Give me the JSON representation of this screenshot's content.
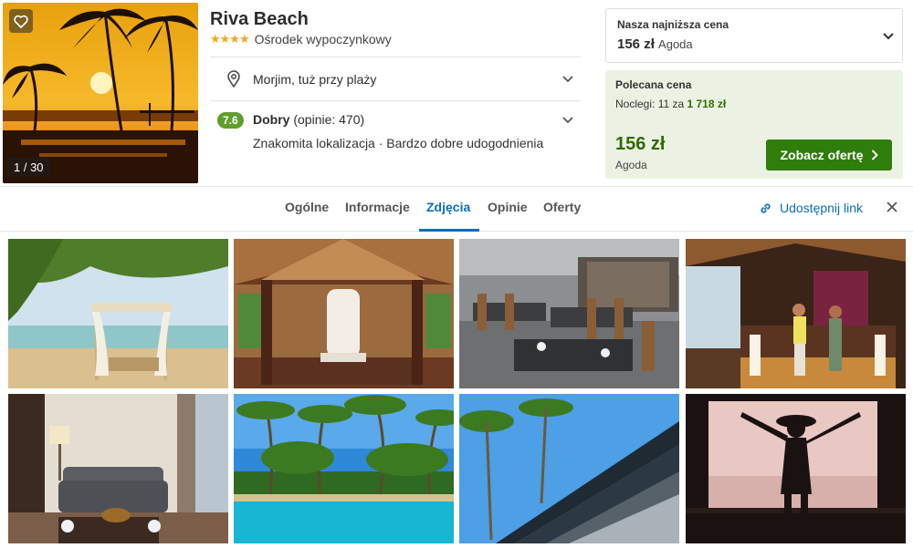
{
  "hotel": {
    "name": "Riva Beach",
    "stars": "★★★★",
    "type": "Ośrodek wypoczynkowy",
    "photo_counter": "1 / 30",
    "location": "Morjim, tuż przy plaży",
    "rating_score": "7.6",
    "rating_label": "Dobry",
    "rating_count": "(opinie: 470)",
    "rating_highlights": "Znakomita lokalizacja · Bardzo dobre udogodnienia"
  },
  "lowest_price": {
    "label": "Nasza najniższa cena",
    "price": "156 zł",
    "provider": "Agoda"
  },
  "recommended": {
    "label": "Polecana cena",
    "nights_prefix": "Noclegi: 11 za",
    "nights_total": "1 718 zł",
    "price": "156 zł",
    "provider": "Agoda",
    "button": "Zobacz ofertę"
  },
  "tabs": [
    {
      "label": "Ogólne"
    },
    {
      "label": "Informacje"
    },
    {
      "label": "Zdjęcia"
    },
    {
      "label": "Opinie"
    },
    {
      "label": "Oferty"
    }
  ],
  "active_tab": "Zdjęcia",
  "share_label": "Udostępnij link",
  "gallery": [
    {
      "subject": "beach-cabana"
    },
    {
      "subject": "lobby-sculpture"
    },
    {
      "subject": "restaurant"
    },
    {
      "subject": "reception"
    },
    {
      "subject": "room-sofa"
    },
    {
      "subject": "pool-palms"
    },
    {
      "subject": "waterfall-wall"
    },
    {
      "subject": "sunset-silhouette"
    }
  ],
  "icons": {
    "favorite": "heart-icon",
    "location": "map-pin-icon",
    "expand": "chevron-down-icon",
    "button_arrow": "chevron-right-icon",
    "share": "link-icon",
    "close": "close-icon"
  },
  "colors": {
    "accent_blue": "#0a6fbf",
    "button_green": "#2f7d0b",
    "rating_green": "#5f9e2b",
    "rec_background": "#ebf2e3",
    "stars": "#f4a622"
  }
}
